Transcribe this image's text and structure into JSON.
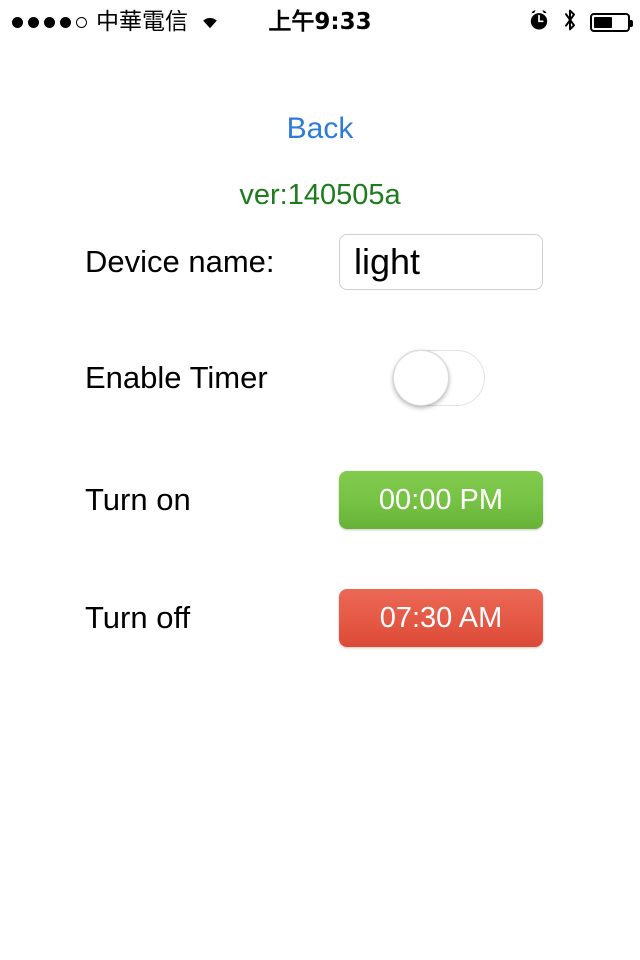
{
  "statusbar": {
    "signal_filled": 4,
    "signal_total": 5,
    "carrier": "中華電信",
    "wifi_icon": "wifi-icon",
    "time": "上午9:33",
    "alarm_icon": "alarm-clock-icon",
    "bluetooth_icon": "bluetooth-icon",
    "battery_percent": 50
  },
  "page": {
    "back_label": "Back",
    "version_label": "ver:140505a",
    "back_color": "#2f7cd8",
    "version_color": "#1e7b1e"
  },
  "fields": {
    "device_name_label": "Device name:",
    "device_name_value": "light",
    "device_name_placeholder": "",
    "enable_timer_label": "Enable Timer",
    "enable_timer_on": false,
    "turn_on_label": "Turn on",
    "turn_on_time": "00:00 PM",
    "turn_on_color": "#77c345",
    "turn_off_label": "Turn off",
    "turn_off_time": "07:30 AM",
    "turn_off_color": "#e05543"
  }
}
